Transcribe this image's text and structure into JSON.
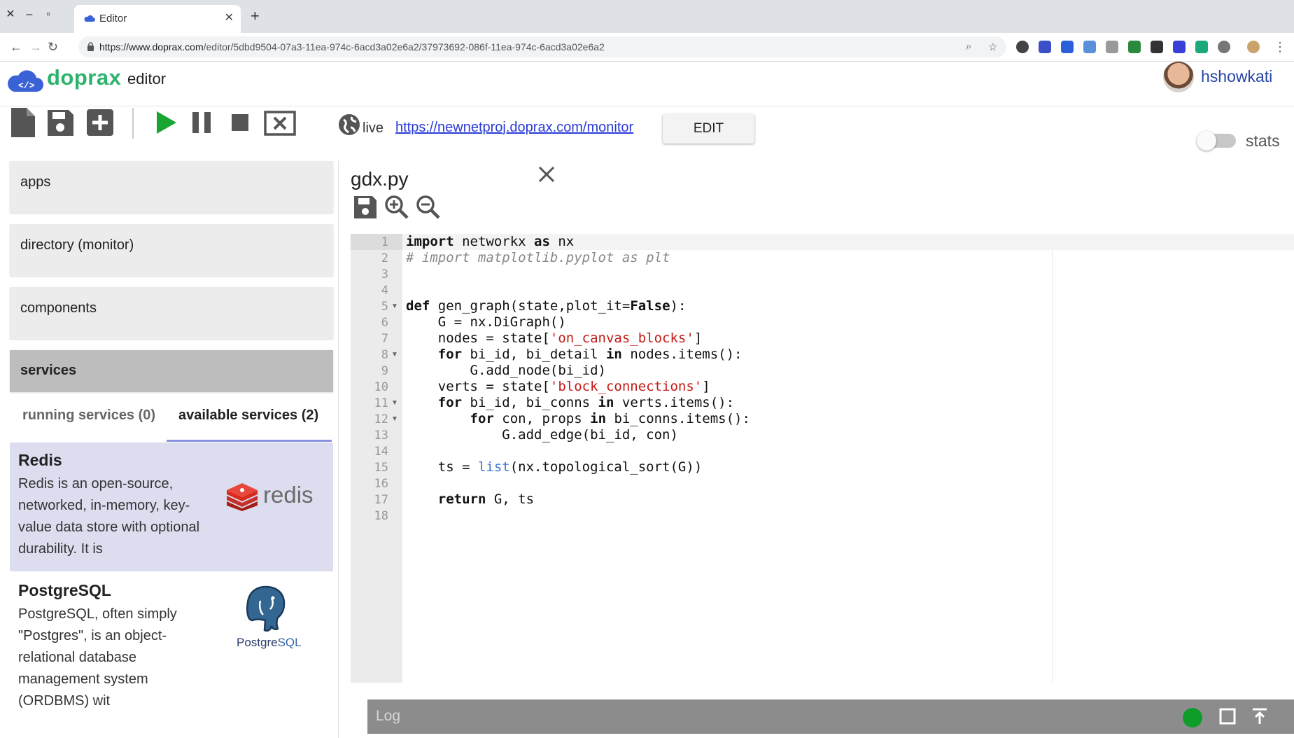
{
  "browser": {
    "tab_title": "Editor",
    "url_host": "https://www.doprax.com",
    "url_path": "/editor/5dbd9504-07a3-11ea-974c-6acd3a02e6a2/37973692-086f-11ea-974c-6acd3a02e6a2"
  },
  "header": {
    "brand": "doprax",
    "brand_sub": "editor",
    "username": "hshowkati"
  },
  "toolbar": {
    "live_label": "live",
    "live_url": "https://newnetproj.doprax.com/monitor",
    "edit_label": "EDIT",
    "stats_label": "stats"
  },
  "sidebar": {
    "sections": [
      {
        "label": "apps"
      },
      {
        "label": "directory (monitor)"
      },
      {
        "label": "components"
      },
      {
        "label": "services"
      }
    ],
    "service_tabs": [
      {
        "label": "running services (0)"
      },
      {
        "label": "available services (2)"
      }
    ],
    "services": [
      {
        "name": "Redis",
        "description": "Redis is an open-source, networked, in-memory, key-value data store with optional durability. It is",
        "logo_text": "redis"
      },
      {
        "name": "PostgreSQL",
        "description": "PostgreSQL, often simply \"Postgres\", is an object-relational database management system (ORDBMS) wit",
        "logo_text_a": "Postgre",
        "logo_text_b": "SQL"
      }
    ]
  },
  "editor": {
    "filename": "gdx.py",
    "line_numbers": [
      "1",
      "2",
      "3",
      "4",
      "5",
      "6",
      "7",
      "8",
      "9",
      "10",
      "11",
      "12",
      "13",
      "14",
      "15",
      "16",
      "17",
      "18"
    ]
  },
  "log": {
    "label": "Log",
    "status_color": "#0f9d2a"
  }
}
